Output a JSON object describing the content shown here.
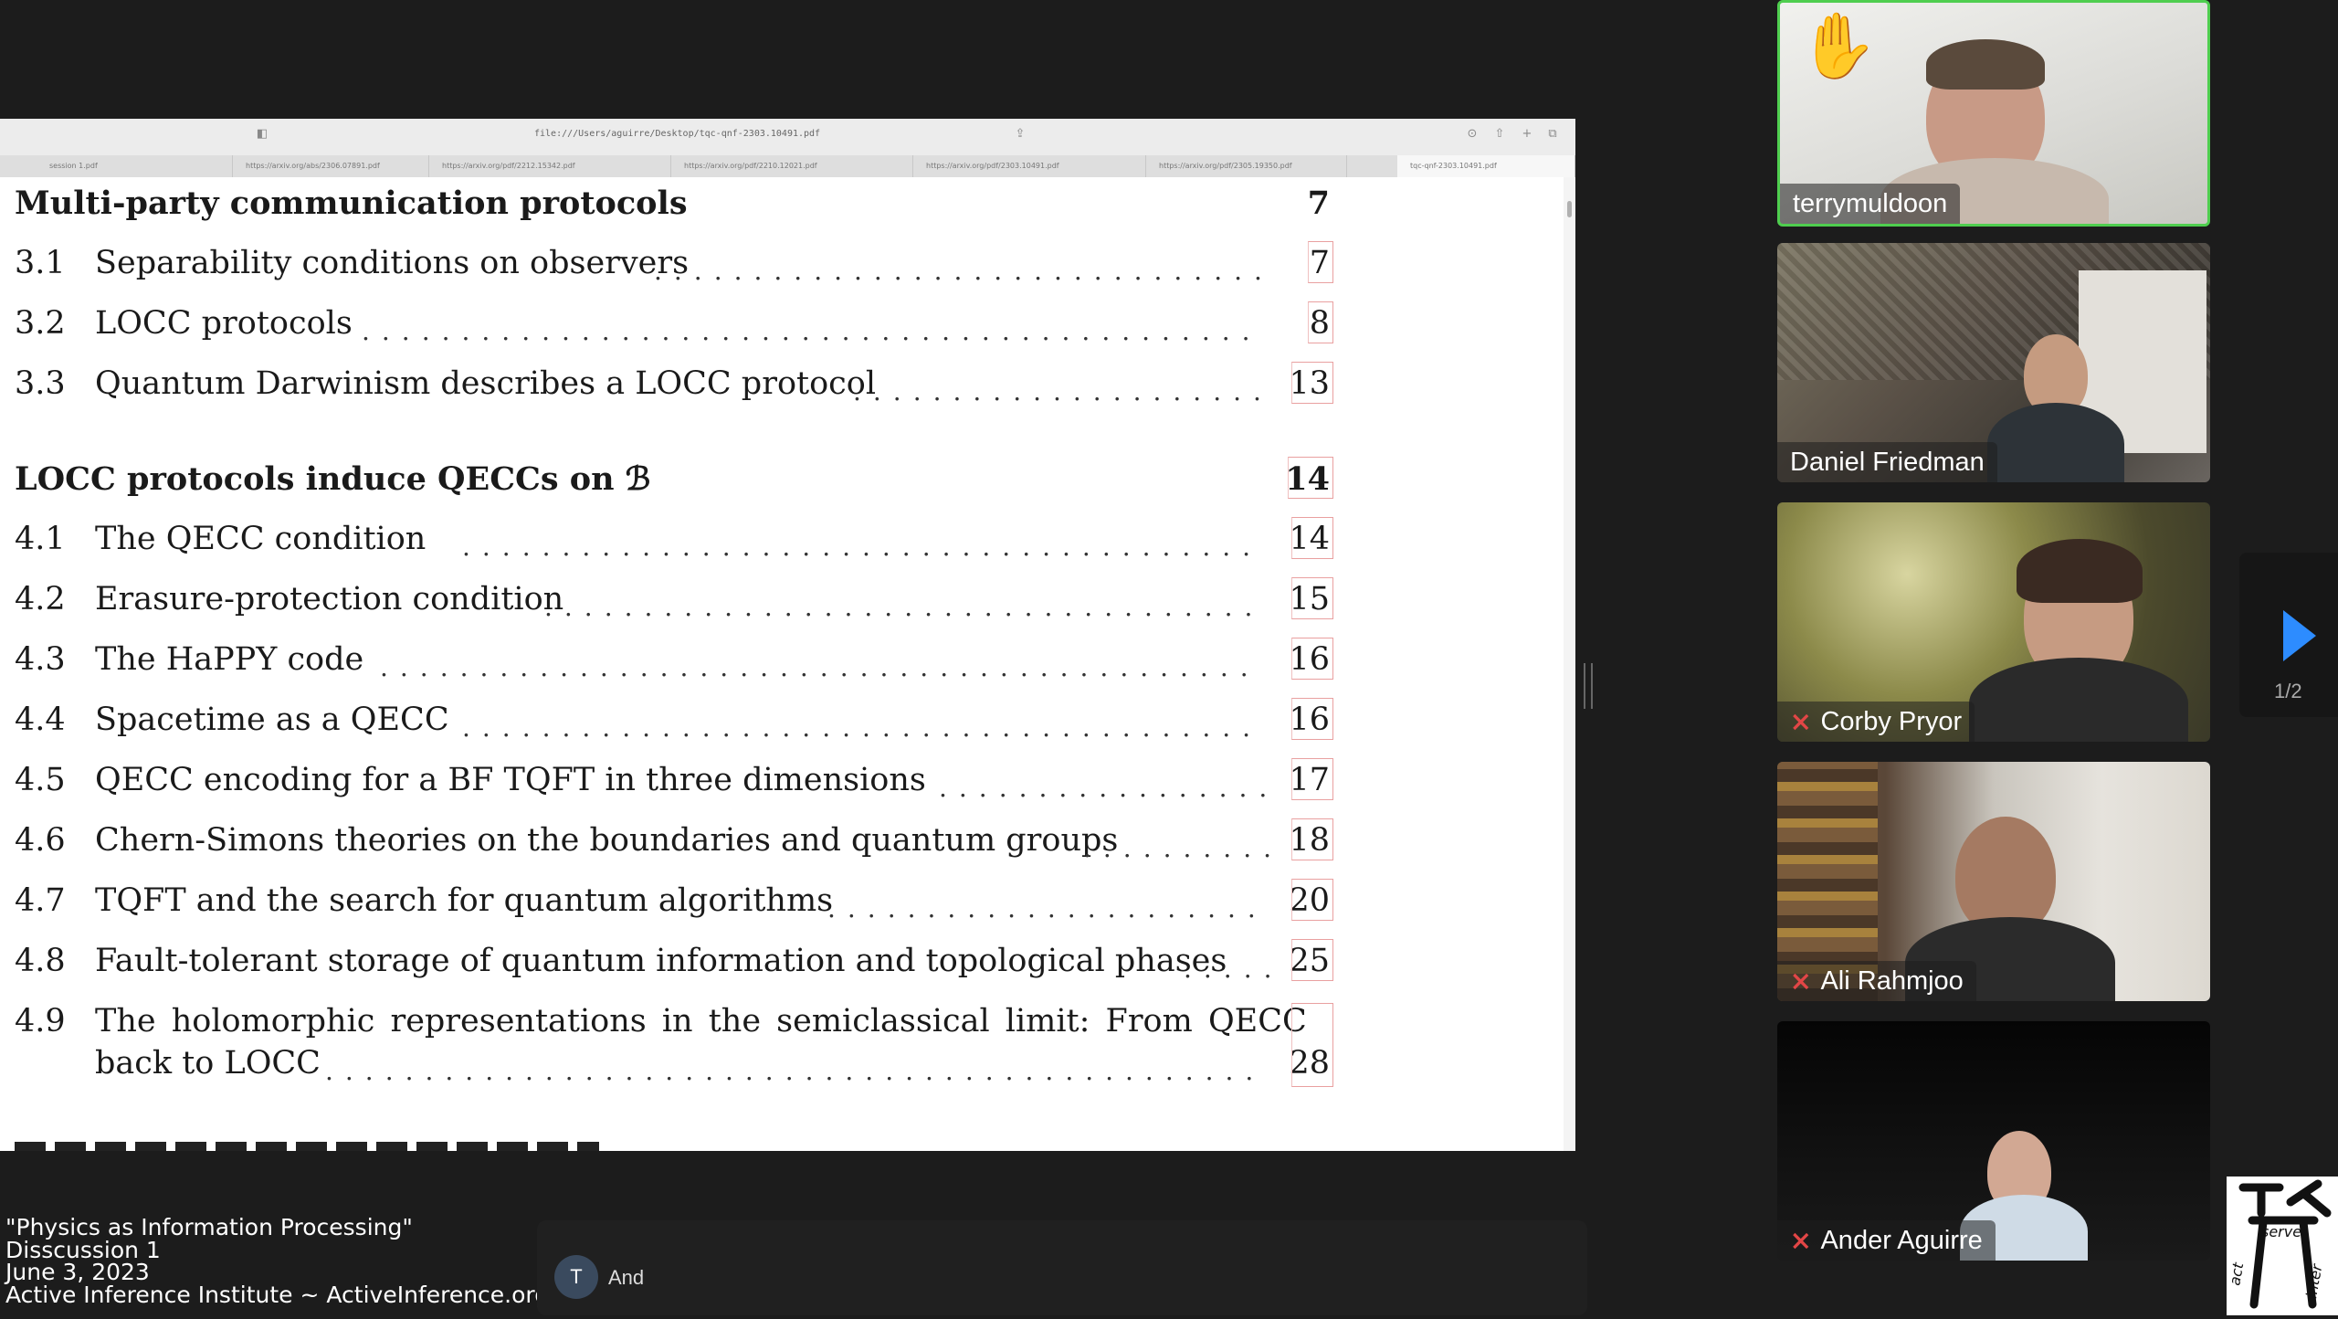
{
  "browser": {
    "url": "file:///Users/aguirre/Desktop/tqc-qnf-2303.10491.pdf",
    "tabs": [
      "session 1.pdf",
      "https://arxiv.org/abs/2306.07891.pdf",
      "https://arxiv.org/pdf/2212.15342.pdf",
      "https://arxiv.org/pdf/2210.12021.pdf",
      "https://arxiv.org/pdf/2303.10491.pdf",
      "https://arxiv.org/pdf/2305.19350.pdf",
      "tqc-qnf-2303.10491.pdf"
    ]
  },
  "toc": {
    "section3": {
      "title": "Multi-party communication protocols",
      "page": "7"
    },
    "s3_items": [
      {
        "num": "3.1",
        "title": "Separability conditions on observers",
        "page": "7"
      },
      {
        "num": "3.2",
        "title": "LOCC protocols",
        "page": "8"
      },
      {
        "num": "3.3",
        "title": "Quantum Darwinism describes a LOCC protocol",
        "page": "13"
      }
    ],
    "section4": {
      "title": "LOCC protocols induce QECCs on ℬ",
      "page": "14"
    },
    "s4_items": [
      {
        "num": "4.1",
        "title": "The QECC condition",
        "page": "14"
      },
      {
        "num": "4.2",
        "title": "Erasure-protection condition",
        "page": "15"
      },
      {
        "num": "4.3",
        "title": "The HaPPY code",
        "page": "16"
      },
      {
        "num": "4.4",
        "title": "Spacetime as a QECC",
        "page": "16"
      },
      {
        "num": "4.5",
        "title": "QECC encoding for a BF TQFT in three dimensions",
        "page": "17"
      },
      {
        "num": "4.6",
        "title": "Chern-Simons theories on the boundaries and quantum groups",
        "page": "18"
      },
      {
        "num": "4.7",
        "title": "TQFT and the search for quantum algorithms",
        "page": "20"
      },
      {
        "num": "4.8",
        "title": "Fault-tolerant storage of quantum information and topological phases",
        "page": "25"
      }
    ],
    "s4_9": {
      "num": "4.9",
      "title_line1": "The holomorphic representations in the semiclassical limit:  From QECC",
      "title_line2": "back to LOCC",
      "page": "28"
    }
  },
  "participants": [
    {
      "name": "terrymuldoon",
      "muted": false,
      "hand_raised": true,
      "speaking": true
    },
    {
      "name": "Daniel Friedman",
      "muted": false
    },
    {
      "name": "Corby Pryor",
      "muted": true
    },
    {
      "name": "Ali Rahmjoo",
      "muted": true
    },
    {
      "name": "Ander Aguirre",
      "muted": true
    }
  ],
  "pager": {
    "text": "1/2"
  },
  "caption": {
    "line1": "\"Physics as Information Processing\"",
    "line2": "Disscussion 1",
    "line3": "June 3, 2023",
    "line4": "Active Inference Institute ~ ActiveInference.org"
  },
  "chat": {
    "avatar_initial": "T",
    "name": "And"
  },
  "logo": {
    "top": "serve",
    "left": "act",
    "right": "inter"
  },
  "colors": {
    "speaking_border": "#4fce4f",
    "muted_icon": "#e24646",
    "accent": "#2d8cff",
    "background": "#1c1c1c"
  }
}
